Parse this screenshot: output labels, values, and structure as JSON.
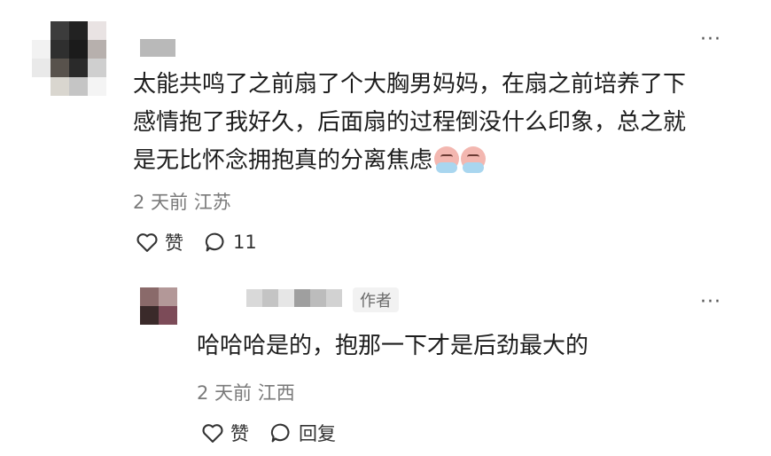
{
  "main_comment": {
    "more_label": "···",
    "text_lines": [
      "太能共鸣了之前扇了个大胸男妈妈，在扇之前培养了下",
      "感情抱了我好久，后面扇的过程倒没什么印象，总之就",
      "是无比怀念拥抱真的分离焦虑"
    ],
    "emoji_icons": [
      "crying-face-icon",
      "crying-face-icon"
    ],
    "meta": "2 天前  江苏",
    "like_label": "赞",
    "comment_count": "11"
  },
  "reply": {
    "more_label": "···",
    "author_badge": "作者",
    "text": "哈哈哈是的，抱那一下才是后劲最大的",
    "meta": "2 天前  江西",
    "like_label": "赞",
    "reply_label": "回复"
  },
  "colors": {
    "text_primary": "#1d1d1d",
    "text_meta": "#7a7a7a",
    "badge_bg": "#f2f2f2",
    "blurred_name": "#b9b9b9"
  }
}
